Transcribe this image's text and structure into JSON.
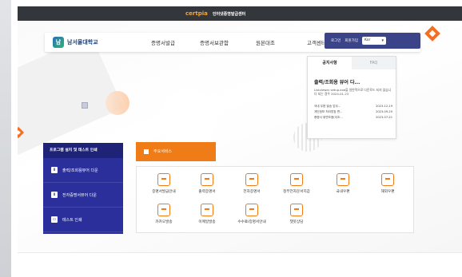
{
  "topbar": {
    "logo": "certpia",
    "site_name": "인터넷증명발급센터"
  },
  "header": {
    "university": "남서울대학교",
    "nav": [
      "증명서발급",
      "증명서보관함",
      "원본대조",
      "고객센터"
    ],
    "user": {
      "login": "로그인",
      "signup": "회원가입",
      "language": "Kor"
    }
  },
  "notice": {
    "tabs": [
      "공지사항",
      "FAQ"
    ],
    "headline": "출력/조회용 뷰어 다...",
    "description": "Listviewer setup.exe을 일반적으로 다운로드 되지 않습니다 되는 경우 2024-01-23",
    "items": [
      {
        "title": "국내 우편 발송 업무...",
        "date": "2023-12-19"
      },
      {
        "title": "개인정보 처리방침 변...",
        "date": "2023-09-20"
      },
      {
        "title": "증명서 위변조용(이조...",
        "date": "2023-07-21"
      }
    ]
  },
  "menu": {
    "title": "프로그램 설치 및 테스트 인쇄",
    "items": [
      "출력/조회용뷰어 다운",
      "전자증명서뷰어 다운",
      "테스트 인쇄"
    ]
  },
  "services": {
    "title": "주요서비스",
    "row1": [
      "증명서발급안내",
      "출력증명서",
      "전자증명서",
      "정부전자문서지갑",
      "국내우편",
      "해외우편"
    ],
    "row2": [
      "카카오발송",
      "이메일발송",
      "수수료/증명서안내",
      "챗봇상담"
    ]
  },
  "colors": {
    "orange": "#f07c17",
    "navy": "#2a2f9b",
    "dark_topbar": "#33363b"
  }
}
